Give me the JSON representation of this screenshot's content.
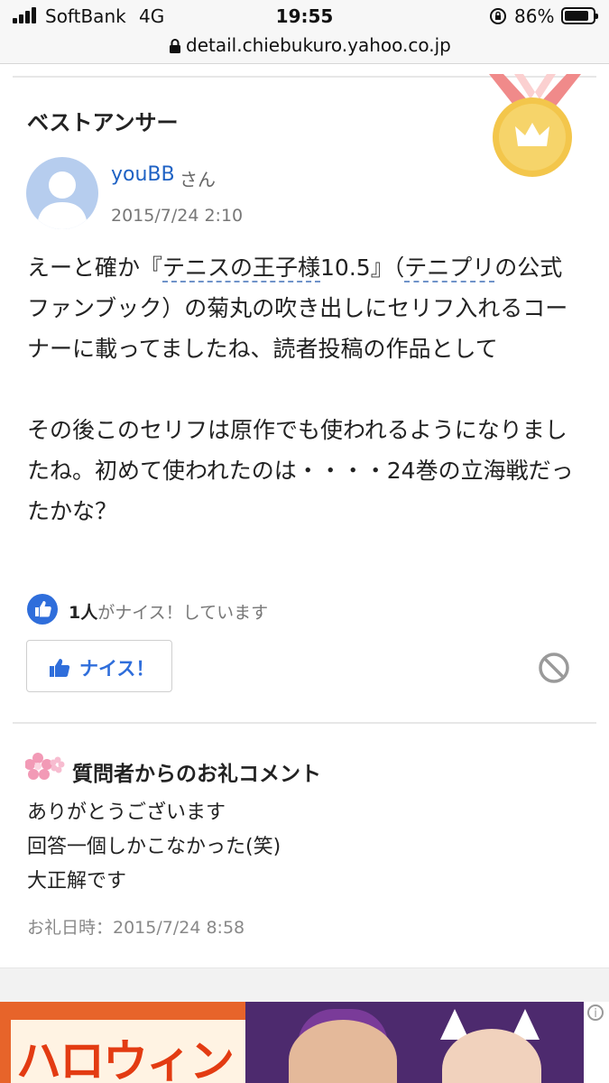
{
  "status_bar": {
    "carrier": "SoftBank",
    "network": "4G",
    "time": "19:55",
    "battery_percent": "86%",
    "battery_level": 0.86
  },
  "browser": {
    "url": "detail.chiebukuro.yahoo.co.jp"
  },
  "best_answer": {
    "title": "ベストアンサー",
    "username": "youBB",
    "honorific": "さん",
    "date": "2015/7/24 2:10",
    "body_pre": "えーと確か『",
    "keyword1": "テニスの王子様",
    "body_mid1": "10.5』（",
    "keyword2": "テニプリ",
    "body_mid2": "の公式ファンブック）の菊丸の吹き出しにセリフ入れるコーナーに載ってましたね、読者投稿の作品として",
    "paragraph2": "その後このセリフは原作でも使われるようになりましたね。初めて使われたのは・・・・24巻の立海戦だったかな？",
    "nice_count": "1人",
    "nice_suffix": "がナイス！しています",
    "nice_button": "ナイス！"
  },
  "thanks": {
    "title": "質問者からのお礼コメント",
    "lines": [
      "ありがとうございます",
      "回答一個しかこなかった(笑)",
      "大正解です"
    ],
    "date_label": "お礼日時：2015/7/24 8:58"
  },
  "ad": {
    "text": "ハロウィン"
  },
  "colors": {
    "link": "#1f62c4",
    "accent": "#2f6edb",
    "medal_gold": "#f3c64b",
    "medal_ribbon": "#f07a7a"
  }
}
